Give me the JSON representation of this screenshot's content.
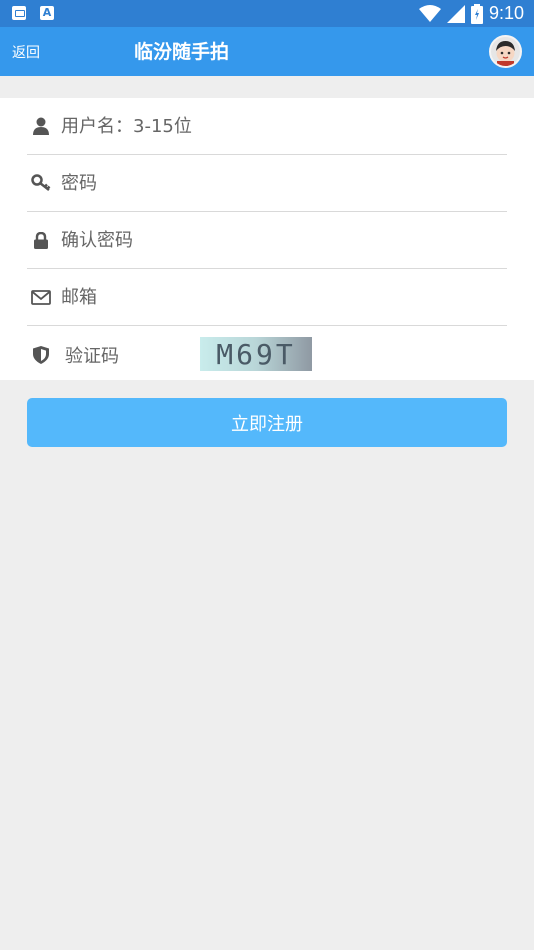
{
  "statusbar": {
    "time": "9:10",
    "icons": [
      "mail-icon",
      "a-icon",
      "wifi-icon",
      "signal-icon",
      "battery-icon"
    ]
  },
  "appbar": {
    "back_label": "返回",
    "title": "临汾随手拍",
    "avatar_icon": "user-avatar"
  },
  "form": {
    "username_placeholder": "用户名：3-15位",
    "password_placeholder": "密码",
    "confirm_placeholder": "确认密码",
    "email_placeholder": "邮箱",
    "captcha_label": "验证码",
    "captcha_text": "M69T"
  },
  "actions": {
    "register_label": "立即注册"
  },
  "colors": {
    "statusbar": "#2f7fd2",
    "appbar": "#3598ec",
    "button": "#54b8fb",
    "background": "#eeeeee"
  }
}
